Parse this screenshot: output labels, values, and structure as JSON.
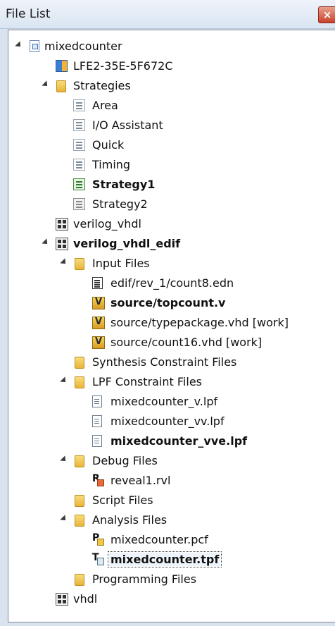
{
  "window": {
    "title": "File List",
    "close_glyph": "×"
  },
  "tree": [
    {
      "key": "project",
      "label": "mixedcounter",
      "bold": false,
      "expanded": true,
      "icon": "project-icon"
    },
    {
      "key": "device",
      "label": "LFE2-35E-5F672C",
      "bold": false,
      "expanded": null,
      "icon": "device-icon"
    },
    {
      "key": "strategies",
      "label": "Strategies",
      "bold": false,
      "expanded": true,
      "icon": "folder-icon"
    },
    {
      "key": "area",
      "label": "Area",
      "bold": false,
      "expanded": null,
      "icon": "strategy-icon"
    },
    {
      "key": "io",
      "label": "I/O Assistant",
      "bold": false,
      "expanded": null,
      "icon": "strategy-icon"
    },
    {
      "key": "quick",
      "label": "Quick",
      "bold": false,
      "expanded": null,
      "icon": "strategy-icon"
    },
    {
      "key": "timing",
      "label": "Timing",
      "bold": false,
      "expanded": null,
      "icon": "strategy-icon"
    },
    {
      "key": "strategy1",
      "label": "Strategy1",
      "bold": true,
      "expanded": null,
      "icon": "strategy-active-icon"
    },
    {
      "key": "strategy2",
      "label": "Strategy2",
      "bold": false,
      "expanded": null,
      "icon": "strategy-inactive-icon"
    },
    {
      "key": "verilog_vhdl",
      "label": "verilog_vhdl",
      "bold": false,
      "expanded": null,
      "icon": "implementation-icon"
    },
    {
      "key": "verilog_vhdl_edif",
      "label": "verilog_vhdl_edif",
      "bold": true,
      "expanded": true,
      "icon": "implementation-icon"
    },
    {
      "key": "input_files",
      "label": "Input Files",
      "bold": false,
      "expanded": true,
      "icon": "folder-icon"
    },
    {
      "key": "count8",
      "label": "edif/rev_1/count8.edn",
      "bold": false,
      "expanded": null,
      "icon": "edn-file-icon"
    },
    {
      "key": "topcount",
      "label": "source/topcount.v",
      "bold": true,
      "expanded": null,
      "icon": "hdl-file-icon"
    },
    {
      "key": "typepackage",
      "label": "source/typepackage.vhd [work]",
      "bold": false,
      "expanded": null,
      "icon": "hdl-file-icon"
    },
    {
      "key": "count16",
      "label": "source/count16.vhd [work]",
      "bold": false,
      "expanded": null,
      "icon": "hdl-file-icon"
    },
    {
      "key": "synth_constraint",
      "label": "Synthesis Constraint Files",
      "bold": false,
      "expanded": null,
      "icon": "folder-icon"
    },
    {
      "key": "lpf_constraint",
      "label": "LPF Constraint Files",
      "bold": false,
      "expanded": true,
      "icon": "folder-icon"
    },
    {
      "key": "lpf_v",
      "label": "mixedcounter_v.lpf",
      "bold": false,
      "expanded": null,
      "icon": "lpf-file-icon"
    },
    {
      "key": "lpf_vv",
      "label": "mixedcounter_vv.lpf",
      "bold": false,
      "expanded": null,
      "icon": "lpf-file-icon"
    },
    {
      "key": "lpf_vve",
      "label": "mixedcounter_vve.lpf",
      "bold": true,
      "expanded": null,
      "icon": "lpf-file-icon"
    },
    {
      "key": "debug_files",
      "label": "Debug Files",
      "bold": false,
      "expanded": true,
      "icon": "folder-icon"
    },
    {
      "key": "reveal1",
      "label": "reveal1.rvl",
      "bold": false,
      "expanded": null,
      "icon": "reveal-file-icon"
    },
    {
      "key": "script_files",
      "label": "Script Files",
      "bold": false,
      "expanded": null,
      "icon": "folder-icon"
    },
    {
      "key": "analysis_files",
      "label": "Analysis Files",
      "bold": false,
      "expanded": true,
      "icon": "folder-icon"
    },
    {
      "key": "pcf",
      "label": "mixedcounter.pcf",
      "bold": false,
      "expanded": null,
      "icon": "pcf-file-icon"
    },
    {
      "key": "tpf",
      "label": "mixedcounter.tpf",
      "bold": true,
      "expanded": null,
      "icon": "tpf-file-icon",
      "selected": true
    },
    {
      "key": "programming_files",
      "label": "Programming Files",
      "bold": false,
      "expanded": null,
      "icon": "folder-icon"
    },
    {
      "key": "vhdl",
      "label": "vhdl",
      "bold": false,
      "expanded": null,
      "icon": "implementation-icon"
    }
  ]
}
